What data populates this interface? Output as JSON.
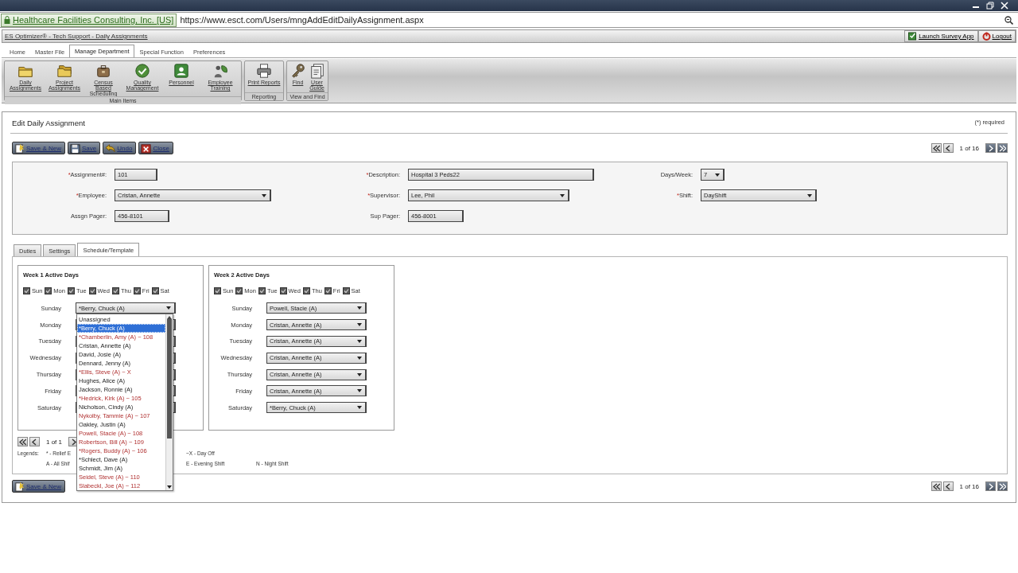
{
  "address_bar": {
    "site_identity": "Healthcare Facilities Consulting, Inc. [US]",
    "url": "https://www.esct.com/Users/mngAddEditDailyAssignment.aspx"
  },
  "app_header": {
    "title": "ES Optimizer® - Tech Support - Daily Assignments",
    "actions": [
      {
        "kind": "survey",
        "label": "Launch Survey App"
      },
      {
        "kind": "logout",
        "label": "Logout"
      }
    ]
  },
  "menu_tabs": [
    {
      "label": "Home",
      "selected": false
    },
    {
      "label": "Master File",
      "selected": false
    },
    {
      "label": "Manage Department",
      "selected": true
    },
    {
      "label": "Special Function",
      "selected": false
    },
    {
      "label": "Preferences",
      "selected": false
    }
  ],
  "ribbon": [
    {
      "group": "Main Items",
      "buttons": [
        {
          "kind": "folder",
          "label": "Daily Assignments"
        },
        {
          "kind": "folders",
          "label": "Project Assignments"
        },
        {
          "kind": "case",
          "label": "Census Based Scheduling"
        },
        {
          "kind": "check",
          "label": "Quality Management"
        },
        {
          "kind": "person",
          "label": "Personnel"
        },
        {
          "kind": "training",
          "label": "Employee Training"
        }
      ]
    },
    {
      "group": "Reporting",
      "buttons": [
        {
          "kind": "printer",
          "label": "Print Reports"
        }
      ]
    },
    {
      "group": "View and Find",
      "buttons": [
        {
          "kind": "key",
          "label": "Find"
        },
        {
          "kind": "guide",
          "label": "User Guide"
        }
      ]
    }
  ],
  "page": {
    "title": "Edit Daily Assignment",
    "required_note": "(*) required",
    "toolbar": [
      {
        "kind": "new",
        "label": "Save & New"
      },
      {
        "kind": "save",
        "label": "Save"
      },
      {
        "kind": "undo",
        "label": "Undo"
      },
      {
        "kind": "close",
        "label": "Close"
      }
    ],
    "pager": "1 of 16",
    "form": [
      [
        {
          "required_mark": "*",
          "label": "Assignment#:",
          "kind": "text",
          "value": "101"
        },
        {
          "required_mark": "*",
          "label": "Description:",
          "kind": "text",
          "value": "Hospital 3 Peds22"
        },
        {
          "label": "Days/Week:",
          "kind": "select",
          "value": "7"
        }
      ],
      [
        {
          "required_mark": "*",
          "label": "Employee:",
          "kind": "select",
          "value": "Cristan, Annette"
        },
        {
          "required_mark": "*",
          "label": "Supervisor:",
          "kind": "select",
          "value": "Lee, Phil"
        },
        {
          "required_mark": "*",
          "label": "Shift:",
          "kind": "select",
          "value": "DayShift"
        }
      ],
      [
        {
          "label": "Assgn Pager:",
          "kind": "text",
          "value": "456-8101"
        },
        {
          "label": "Sup Pager:",
          "kind": "text",
          "value": "456-8001"
        }
      ]
    ],
    "tabs": [
      {
        "label": "Duties",
        "selected": false
      },
      {
        "label": "Settings",
        "selected": false
      },
      {
        "label": "Schedule/Template",
        "selected": true
      }
    ],
    "weeks": [
      {
        "title": "Week 1 Active Days",
        "days": [
          {
            "label": "Sun",
            "checked": true
          },
          {
            "label": "Mon",
            "checked": true
          },
          {
            "label": "Tue",
            "checked": true
          },
          {
            "label": "Wed",
            "checked": true
          },
          {
            "label": "Thu",
            "checked": true
          },
          {
            "label": "Fri",
            "checked": true
          },
          {
            "label": "Sat",
            "checked": true
          }
        ],
        "assignments": [
          {
            "day": "Sunday",
            "value": "*Berry, Chuck (A)",
            "options": [
              {
                "label": "Unassigned",
                "flagged": false,
                "selected": false
              },
              {
                "label": "*Berry, Chuck (A)",
                "flagged": false,
                "selected": true
              },
              {
                "label": "*Chamberlin, Amy (A) ~ 108",
                "flagged": true,
                "selected": false
              },
              {
                "label": "Cristan, Annette (A)",
                "flagged": false,
                "selected": false
              },
              {
                "label": "David, Josie (A)",
                "flagged": false,
                "selected": false
              },
              {
                "label": "Dennard, Jenny (A)",
                "flagged": false,
                "selected": false
              },
              {
                "label": "*Ellis, Steve (A) ~ X",
                "flagged": true,
                "selected": false
              },
              {
                "label": "Hughes, Alice (A)",
                "flagged": false,
                "selected": false
              },
              {
                "label": "Jackson, Ronnie (A)",
                "flagged": false,
                "selected": false
              },
              {
                "label": "*Hedrick, Kirk (A) ~ 105",
                "flagged": true,
                "selected": false
              },
              {
                "label": "Nicholson, Cindy (A)",
                "flagged": false,
                "selected": false
              },
              {
                "label": "Nykolby, Tammie (A) ~ 107",
                "flagged": true,
                "selected": false
              },
              {
                "label": "Oakley, Justin (A)",
                "flagged": false,
                "selected": false
              },
              {
                "label": "Powell, Stacie (A) ~ 108",
                "flagged": true,
                "selected": false
              },
              {
                "label": "Robertson, Bill (A) ~ 109",
                "flagged": true,
                "selected": false
              },
              {
                "label": "*Rogers, Buddy (A) ~ 106",
                "flagged": true,
                "selected": false
              },
              {
                "label": "*Schlect, Dave (A)",
                "flagged": false,
                "selected": false
              },
              {
                "label": "Schmidt, Jim (A)",
                "flagged": false,
                "selected": false
              },
              {
                "label": "Seidel, Steve (A) ~ 110",
                "flagged": true,
                "selected": false
              },
              {
                "label": "Slabeckl, Joe (A) ~ 112",
                "flagged": true,
                "selected": false
              }
            ]
          },
          {
            "day": "Monday"
          },
          {
            "day": "Tuesday"
          },
          {
            "day": "Wednesday"
          },
          {
            "day": "Thursday"
          },
          {
            "day": "Friday"
          },
          {
            "day": "Saturday"
          }
        ]
      },
      {
        "title": "Week 2 Active Days",
        "days": [
          {
            "label": "Sun",
            "checked": true
          },
          {
            "label": "Mon",
            "checked": true
          },
          {
            "label": "Tue",
            "checked": true
          },
          {
            "label": "Wed",
            "checked": true
          },
          {
            "label": "Thu",
            "checked": true
          },
          {
            "label": "Fri",
            "checked": true
          },
          {
            "label": "Sat",
            "checked": true
          }
        ],
        "assignments": [
          {
            "day": "Sunday",
            "value": "Powell, Stacie (A)"
          },
          {
            "day": "Monday",
            "value": "Cristan, Annette (A)"
          },
          {
            "day": "Tuesday",
            "value": "Cristan, Annette (A)"
          },
          {
            "day": "Wednesday",
            "value": "Cristan, Annette (A)"
          },
          {
            "day": "Thursday",
            "value": "Cristan, Annette (A)"
          },
          {
            "day": "Friday",
            "value": "Cristan, Annette (A)"
          },
          {
            "day": "Saturday",
            "value": "*Berry, Chuck (A)"
          }
        ]
      }
    ],
    "schedule_pager": "1 of 1",
    "legend_label": "Legends:",
    "legends": [
      [
        "* - Relief E",
        "~X - Day Off"
      ],
      [
        "A - All Shif",
        "E - Evening Shift",
        "N - Night Shift"
      ]
    ],
    "bottom_toolbar": [
      {
        "kind": "new",
        "label": "Save & New"
      }
    ],
    "bottom_pager": "1 of 16"
  }
}
